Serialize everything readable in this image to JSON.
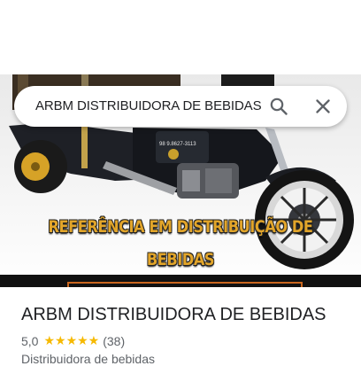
{
  "search": {
    "query": "ARBM DISTRIBUIDORA DE BEBIDAS",
    "search_icon": "search-icon",
    "close_icon": "close-icon"
  },
  "photo": {
    "banner_line1": "REFERÊNCIA EM DISTRIBUIÇÃO DE",
    "banner_line2": "BEBIDAS",
    "vehicle_phone": "98 9.8627-3113"
  },
  "place": {
    "name": "ARBM DISTRIBUIDORA DE BEBIDAS",
    "rating": "5,0",
    "stars": "★★★★★",
    "review_count": "(38)",
    "category": "Distribuidora de bebidas"
  },
  "colors": {
    "star": "#f6b900",
    "banner_text": "#e2a52a",
    "title": "#202124",
    "secondary": "#5f6368"
  }
}
